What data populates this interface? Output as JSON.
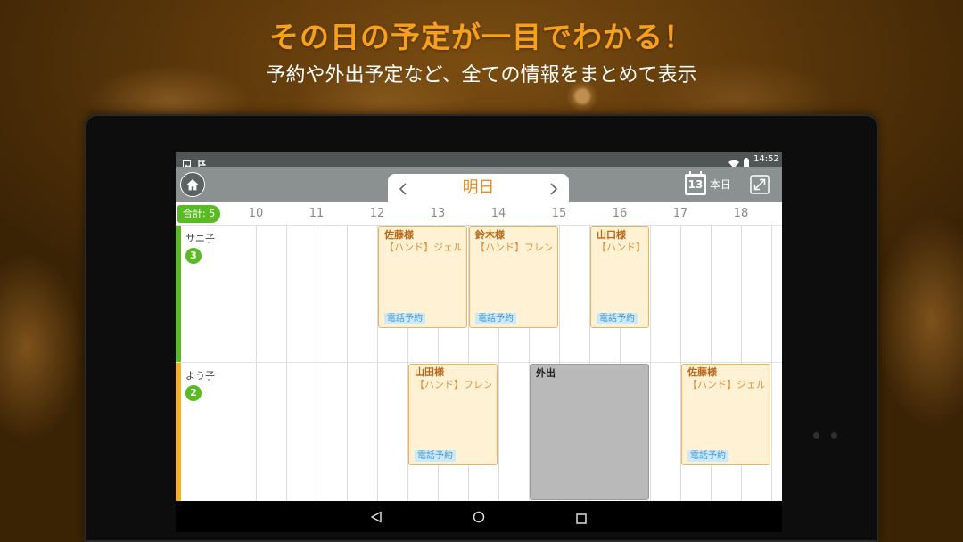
{
  "promo": {
    "headline": "その日の予定が一目でわかる！",
    "subheadline": "予約や外出予定など、全ての情報をまとめて表示"
  },
  "status_bar": {
    "time": "14:52",
    "icons": [
      "image-icon",
      "flag-icon",
      "wifi-icon",
      "battery-icon"
    ]
  },
  "header": {
    "date_label": "明日",
    "calendar_day": "13",
    "today_label": "本日",
    "icons": [
      "home-icon",
      "chevron-left-icon",
      "chevron-right-icon",
      "calendar-icon",
      "expand-icon"
    ]
  },
  "timeline": {
    "total_label": "合計: 5",
    "hours": [
      "10",
      "11",
      "12",
      "13",
      "14",
      "15",
      "16",
      "17",
      "18"
    ]
  },
  "staff": [
    {
      "name": "サニ子",
      "count": "3",
      "color": "#5aba23",
      "appointments": [
        {
          "customer": "佐藤様",
          "service": "【ハンド】ジェル",
          "tag": "電話予約",
          "start": 12,
          "end": 13.5
        },
        {
          "customer": "鈴木様",
          "service": "【ハンド】フレン",
          "tag": "電話予約",
          "start": 13.5,
          "end": 15
        },
        {
          "customer": "山口様",
          "service": "【ハンド】",
          "tag": "電話予約",
          "start": 15.5,
          "end": 16.5
        }
      ],
      "outings": []
    },
    {
      "name": "よう子",
      "count": "2",
      "color": "#f5b023",
      "appointments": [
        {
          "customer": "山田様",
          "service": "【ハンド】フレン",
          "tag": "電話予約",
          "start": 12.5,
          "end": 14
        },
        {
          "customer": "佐藤様",
          "service": "【ハンド】ジェル",
          "tag": "電話予約",
          "start": 17,
          "end": 18.5
        }
      ],
      "outings": [
        {
          "label": "外出",
          "start": 14.5,
          "end": 16.5
        }
      ]
    }
  ],
  "nav_bar": {
    "icons": [
      "back-icon",
      "home-circle-icon",
      "recent-apps-icon"
    ]
  },
  "colors": {
    "headline": "#f6a01c",
    "accent_green": "#5aba23",
    "date_label": "#f08a1c",
    "card_fill": "#fff2d4",
    "card_border": "#f0b25e",
    "outing_fill": "#b9b9b9",
    "tag_fill": "#cfe8f7",
    "tag_text": "#3d9ad6"
  }
}
